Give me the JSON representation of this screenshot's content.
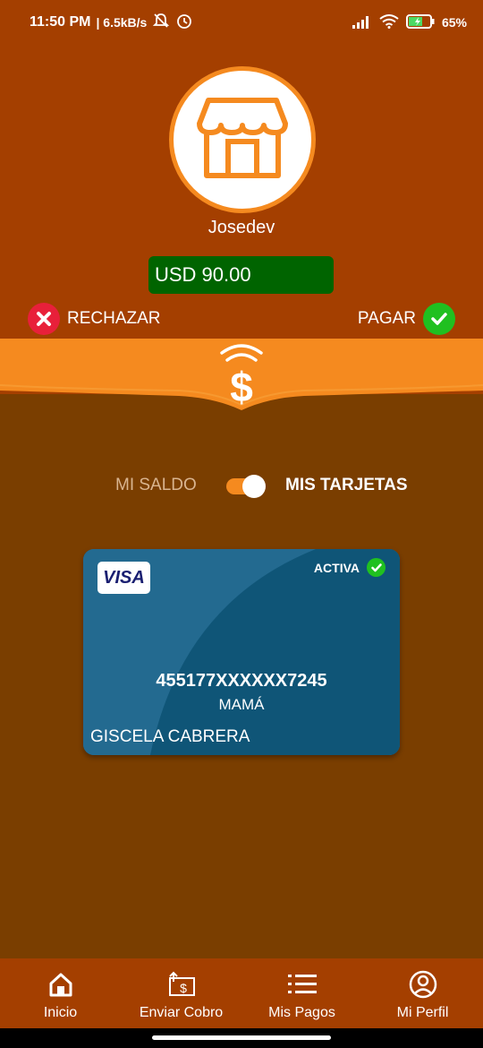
{
  "status_bar": {
    "time": "11:50 PM",
    "speed": "| 6.5kB/s",
    "battery": "65%",
    "icons": [
      "mute-icon",
      "alarm-icon",
      "signal-icon",
      "wifi-icon",
      "battery-icon"
    ]
  },
  "merchant": {
    "icon": "store-icon",
    "name": "Josedev",
    "amount": "USD 90.00"
  },
  "actions": {
    "reject_label": "RECHAZAR",
    "pay_label": "PAGAR"
  },
  "toggle": {
    "left_label": "MI SALDO",
    "right_label": "MIS TARJETAS",
    "selected": "MIS TARJETAS"
  },
  "card": {
    "brand": "VISA",
    "status": "ACTIVA",
    "number": "455177XXXXXX7245",
    "alias": "MAMÁ",
    "holder": "GISCELA CABRERA"
  },
  "nav": {
    "items": [
      {
        "label": "Inicio",
        "icon": "home-icon"
      },
      {
        "label": "Enviar Cobro",
        "icon": "send-payment-icon"
      },
      {
        "label": "Mis Pagos",
        "icon": "list-icon"
      },
      {
        "label": "Mi Perfil",
        "icon": "profile-icon"
      }
    ]
  },
  "colors": {
    "header": "#a43f00",
    "background": "#7a3e00",
    "accent": "#f58a1f",
    "amount_box": "#006400",
    "card": "#216890"
  }
}
